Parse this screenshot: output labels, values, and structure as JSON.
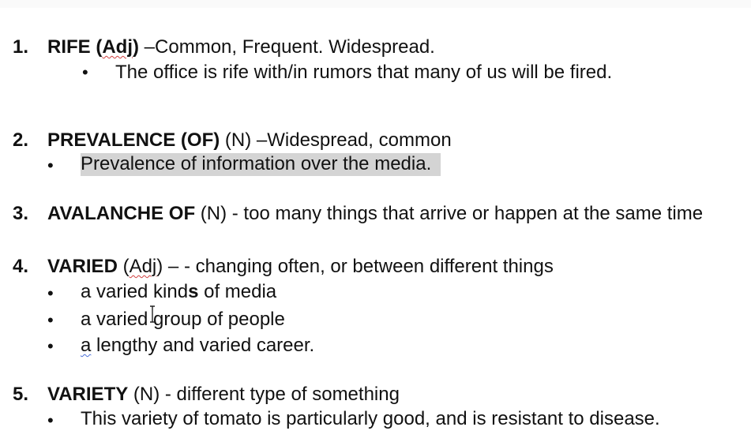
{
  "entries": [
    {
      "number": "1.",
      "term": "RIFE",
      "pos_prefix": " (",
      "pos": "Adj",
      "pos_suffix": ")",
      "definition": " –Common, Frequent.  Widespread.",
      "examples": [
        "The office is rife with/in rumors that many of us will be fired."
      ]
    },
    {
      "number": "2.",
      "term": "PREVALENCE (OF)",
      "pos_label": " (N)",
      "definition": " –Widespread, common",
      "examples": [
        "Prevalence of information over the media."
      ]
    },
    {
      "number": "3.",
      "term": "AVALANCHE OF",
      "pos_label": " (N)",
      "definition": " - too many things that arrive or happen at the same time"
    },
    {
      "number": "4.",
      "term": "VARIED",
      "pos_prefix": " (",
      "pos": "Adj",
      "pos_suffix": ")",
      "definition": " – - changing often, or between different things",
      "examples": [
        {
          "a": "a varied kind",
          "b": "s",
          "c": " of media"
        },
        "a varied group of people",
        {
          "a": "a",
          "c": " lengthy and varied career."
        }
      ]
    },
    {
      "number": "5.",
      "term": "VARIETY",
      "pos_label": " (N)",
      "definition": " - different type of something",
      "examples": [
        "This variety of tomato is particularly good, and is resistant to disease."
      ]
    }
  ],
  "bullet_glyph": "•",
  "highlight_color": "#d4d4d4",
  "spellcheck_color": "#d04040"
}
